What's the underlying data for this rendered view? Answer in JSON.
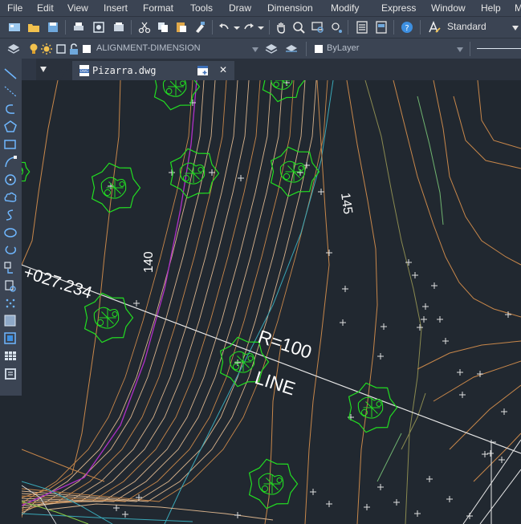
{
  "menu": [
    "File",
    "Edit",
    "View",
    "Insert",
    "Format",
    "Tools",
    "Draw",
    "Dimension",
    "Modify",
    "Express",
    "Window",
    "Help",
    "M"
  ],
  "toolbar": {
    "text_style": "Standard"
  },
  "layers": {
    "current_layer": "ALIGNMENT-DIMENSION",
    "linetype": "ByLayer"
  },
  "tab": {
    "filename": "Pizarra.dwg",
    "close_glyph": "✕"
  },
  "drawing": {
    "labels": {
      "station": "+027.234",
      "radius": "R=100",
      "segment": "LINE",
      "contour_140": "140",
      "contour_145": "145"
    },
    "colors": {
      "contour": "#c8874a",
      "contour_light": "#d9b38c",
      "tree": "#22dd22",
      "alignment": "#e8e8e8",
      "magenta": "#b030c8",
      "cyan": "#3aa8b8",
      "olive": "#8a8a50"
    }
  }
}
